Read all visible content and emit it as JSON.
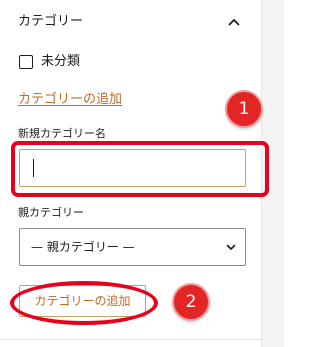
{
  "panel": {
    "title": "カテゴリー",
    "collapse_icon": "chevron-up-icon"
  },
  "categories": [
    {
      "label": "未分類",
      "checked": false
    }
  ],
  "add_category_link": "カテゴリーの追加",
  "new_category": {
    "label": "新規カテゴリー名",
    "value": ""
  },
  "parent_category": {
    "label": "親カテゴリー",
    "selected": "— 親カテゴリー —",
    "dropdown_icon": "chevron-down-icon"
  },
  "submit_button": "カテゴリーの追加",
  "annotations": {
    "step1": "1",
    "step2": "2",
    "highlight_color": "#e8001c"
  },
  "colors": {
    "accent": "#c06a22",
    "badge": "#e32526"
  }
}
